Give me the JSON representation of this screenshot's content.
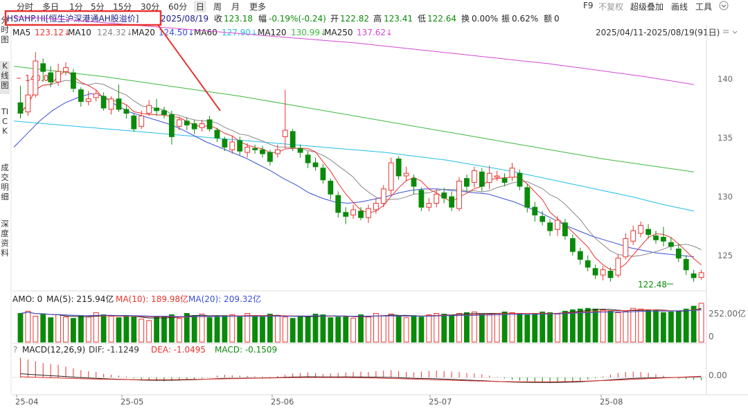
{
  "toolbar": {
    "tabs": [
      "分时",
      "多日",
      "1分",
      "5分",
      "15分",
      "30分",
      "60分",
      "日",
      "周",
      "月",
      "更多"
    ],
    "active_tab": "日",
    "right_items": [
      "F9",
      "不复权",
      "超级叠加",
      "画线",
      "工具"
    ],
    "more_icon": "chevron-down-icon"
  },
  "side_tabs": [
    "分时图",
    "K线图",
    "TICK",
    "成交明细",
    "深度资料"
  ],
  "header": {
    "symbol": "HSAHP.HI[恒生沪深港通AH股溢价]",
    "date": "2025/08/19",
    "close_label": "收",
    "close": "123.18",
    "change_label": "幅",
    "change": "-0.19%(-0.24)",
    "open_label": "开",
    "open": "122.82",
    "high_label": "高",
    "high": "123.41",
    "low_label": "低",
    "low": "122.64",
    "turnover_label": "换",
    "turnover": "0.00%",
    "amplitude_label": "振",
    "amplitude": "0.62%",
    "amount_label": "额",
    "amount": "0"
  },
  "ma_line": {
    "ma5_label": "MA5",
    "ma5": "123.12↓",
    "ma10_label": "MA10",
    "ma10": "124.32↓",
    "ma20_label": "MA20",
    "ma20": "124.50↓",
    "ma60_label": "MA60",
    "ma60": "127.90↓",
    "ma120_label": "MA120",
    "ma120": "130.99↓",
    "ma250_label": "MA250",
    "ma250": "137.62↓",
    "range": "2025/04/11-2025/08/19(91日)"
  },
  "price_axis": [
    "140",
    "135",
    "130",
    "125"
  ],
  "annotations": {
    "max": "140.08",
    "min": "122.48"
  },
  "amo": {
    "label": "AMO: 0",
    "ma5": "MA(5): 215.94亿",
    "ma10": "MA(10): 189.98亿",
    "ma20": "MA(20): 209.32亿",
    "axis_top": "252.00亿",
    "axis_zero": "0"
  },
  "macd": {
    "help": "?",
    "label": "MACD(12,26,9)",
    "dif": "DIF: -1.1249",
    "dea": "DEA: -1.0495",
    "macd": "MACD: -0.1509",
    "axis_zero": "0.00"
  },
  "date_axis": [
    "25-04",
    "25-05",
    "25-06",
    "25-07",
    "25-08"
  ],
  "colors": {
    "up": "#e8332f",
    "down": "#0a8a0a",
    "ma5": "#e8332f",
    "ma10": "#888888",
    "ma20": "#3a4fd8",
    "ma60": "#22bde8",
    "ma120": "#3cb83c",
    "ma250": "#d447d4",
    "highlight": "#e8332f"
  },
  "chart_data": {
    "type": "candlestick",
    "dates_visible": [
      "25-04",
      "25-05",
      "25-06",
      "25-07",
      "25-08"
    ],
    "ylim": [
      122,
      141
    ],
    "candles": [
      {
        "o": 136.2,
        "c": 135.4,
        "h": 137.5,
        "l": 135.0
      },
      {
        "o": 135.5,
        "c": 136.8,
        "h": 138.0,
        "l": 135.2
      },
      {
        "o": 136.8,
        "c": 139.4,
        "h": 140.08,
        "l": 136.6
      },
      {
        "o": 139.2,
        "c": 138.6,
        "h": 139.6,
        "l": 137.8
      },
      {
        "o": 138.5,
        "c": 137.8,
        "h": 139.0,
        "l": 137.4
      },
      {
        "o": 137.8,
        "c": 138.6,
        "h": 139.2,
        "l": 137.5
      },
      {
        "o": 138.6,
        "c": 138.9,
        "h": 139.3,
        "l": 138.3
      },
      {
        "o": 138.5,
        "c": 137.3,
        "h": 138.8,
        "l": 137.0
      },
      {
        "o": 137.2,
        "c": 136.3,
        "h": 137.4,
        "l": 135.9
      },
      {
        "o": 136.3,
        "c": 136.5,
        "h": 137.1,
        "l": 136.0
      },
      {
        "o": 136.6,
        "c": 136.9,
        "h": 137.2,
        "l": 136.3
      },
      {
        "o": 136.7,
        "c": 135.8,
        "h": 137.0,
        "l": 135.6
      },
      {
        "o": 135.7,
        "c": 136.5,
        "h": 136.7,
        "l": 135.3
      },
      {
        "o": 136.5,
        "c": 135.7,
        "h": 137.6,
        "l": 135.5
      },
      {
        "o": 135.7,
        "c": 135.4,
        "h": 136.0,
        "l": 135.0
      },
      {
        "o": 135.2,
        "c": 134.2,
        "h": 135.4,
        "l": 134.0
      },
      {
        "o": 134.4,
        "c": 135.2,
        "h": 135.6,
        "l": 134.2
      },
      {
        "o": 135.4,
        "c": 136.0,
        "h": 136.4,
        "l": 135.2
      },
      {
        "o": 135.8,
        "c": 135.6,
        "h": 136.5,
        "l": 135.2
      },
      {
        "o": 135.6,
        "c": 135.3,
        "h": 135.9,
        "l": 135.0
      },
      {
        "o": 135.3,
        "c": 133.6,
        "h": 135.6,
        "l": 133.0
      },
      {
        "o": 134.4,
        "c": 134.9,
        "h": 135.1,
        "l": 134.1
      },
      {
        "o": 134.8,
        "c": 134.5,
        "h": 135.1,
        "l": 134.1
      },
      {
        "o": 134.6,
        "c": 134.2,
        "h": 134.9,
        "l": 133.8
      },
      {
        "o": 134.3,
        "c": 134.6,
        "h": 134.9,
        "l": 134.0
      },
      {
        "o": 134.9,
        "c": 134.2,
        "h": 135.2,
        "l": 134.0
      },
      {
        "o": 134.1,
        "c": 133.5,
        "h": 134.3,
        "l": 133.2
      },
      {
        "o": 133.4,
        "c": 132.8,
        "h": 133.6,
        "l": 132.5
      },
      {
        "o": 132.6,
        "c": 133.2,
        "h": 133.7,
        "l": 132.3
      },
      {
        "o": 133.3,
        "c": 132.5,
        "h": 133.6,
        "l": 132.2
      },
      {
        "o": 132.4,
        "c": 132.8,
        "h": 133.1,
        "l": 132.0
      },
      {
        "o": 132.7,
        "c": 132.6,
        "h": 133.0,
        "l": 132.3
      },
      {
        "o": 132.6,
        "c": 132.3,
        "h": 132.9,
        "l": 132.0
      },
      {
        "o": 132.4,
        "c": 131.7,
        "h": 132.6,
        "l": 131.4
      },
      {
        "o": 132.3,
        "c": 132.6,
        "h": 133.0,
        "l": 132.0
      },
      {
        "o": 133.6,
        "c": 134.1,
        "h": 137.2,
        "l": 132.7
      },
      {
        "o": 134.0,
        "c": 132.8,
        "h": 134.2,
        "l": 132.5
      },
      {
        "o": 132.7,
        "c": 132.4,
        "h": 133.0,
        "l": 132.0
      },
      {
        "o": 132.2,
        "c": 131.6,
        "h": 132.5,
        "l": 131.2
      },
      {
        "o": 131.6,
        "c": 131.3,
        "h": 132.0,
        "l": 131.0
      },
      {
        "o": 131.2,
        "c": 130.3,
        "h": 131.5,
        "l": 130.0
      },
      {
        "o": 130.2,
        "c": 129.2,
        "h": 130.4,
        "l": 128.8
      },
      {
        "o": 129.1,
        "c": 127.8,
        "h": 129.4,
        "l": 127.4
      },
      {
        "o": 127.8,
        "c": 127.5,
        "h": 128.2,
        "l": 126.9
      },
      {
        "o": 127.6,
        "c": 128.0,
        "h": 128.4,
        "l": 127.3
      },
      {
        "o": 127.9,
        "c": 127.4,
        "h": 128.2,
        "l": 127.2
      },
      {
        "o": 127.4,
        "c": 128.1,
        "h": 128.4,
        "l": 127.0
      },
      {
        "o": 128.0,
        "c": 128.5,
        "h": 128.9,
        "l": 127.7
      },
      {
        "o": 128.5,
        "c": 129.6,
        "h": 129.9,
        "l": 128.2
      },
      {
        "o": 129.5,
        "c": 131.6,
        "h": 132.0,
        "l": 129.1
      },
      {
        "o": 131.9,
        "c": 130.6,
        "h": 132.1,
        "l": 130.3
      },
      {
        "o": 130.6,
        "c": 130.8,
        "h": 131.3,
        "l": 130.2
      },
      {
        "o": 130.4,
        "c": 129.8,
        "h": 130.7,
        "l": 129.2
      },
      {
        "o": 129.5,
        "c": 128.2,
        "h": 129.7,
        "l": 127.9
      },
      {
        "o": 128.2,
        "c": 128.5,
        "h": 128.9,
        "l": 127.9
      },
      {
        "o": 128.5,
        "c": 129.2,
        "h": 129.6,
        "l": 128.2
      },
      {
        "o": 129.3,
        "c": 128.9,
        "h": 129.7,
        "l": 128.5
      },
      {
        "o": 129.0,
        "c": 128.2,
        "h": 129.4,
        "l": 127.9
      },
      {
        "o": 128.1,
        "c": 130.2,
        "h": 130.5,
        "l": 127.9
      },
      {
        "o": 130.4,
        "c": 129.8,
        "h": 130.7,
        "l": 129.4
      },
      {
        "o": 130.1,
        "c": 131.0,
        "h": 131.3,
        "l": 129.7
      },
      {
        "o": 130.9,
        "c": 129.8,
        "h": 131.2,
        "l": 129.4
      },
      {
        "o": 130.1,
        "c": 130.8,
        "h": 131.4,
        "l": 129.6
      },
      {
        "o": 130.5,
        "c": 130.6,
        "h": 131.0,
        "l": 130.2
      },
      {
        "o": 130.4,
        "c": 130.1,
        "h": 130.8,
        "l": 129.8
      },
      {
        "o": 130.5,
        "c": 131.2,
        "h": 131.6,
        "l": 130.2
      },
      {
        "o": 130.8,
        "c": 129.8,
        "h": 131.1,
        "l": 129.5
      },
      {
        "o": 129.7,
        "c": 128.2,
        "h": 130.0,
        "l": 127.8
      },
      {
        "o": 128.2,
        "c": 127.6,
        "h": 128.6,
        "l": 127.1
      },
      {
        "o": 127.5,
        "c": 127.1,
        "h": 127.9,
        "l": 126.8
      },
      {
        "o": 127.0,
        "c": 126.4,
        "h": 127.3,
        "l": 126.0
      },
      {
        "o": 126.5,
        "c": 127.2,
        "h": 127.5,
        "l": 126.0
      },
      {
        "o": 127.0,
        "c": 126.0,
        "h": 127.3,
        "l": 125.7
      },
      {
        "o": 125.8,
        "c": 124.8,
        "h": 126.1,
        "l": 124.5
      },
      {
        "o": 124.8,
        "c": 124.2,
        "h": 125.1,
        "l": 123.8
      },
      {
        "o": 124.1,
        "c": 123.6,
        "h": 124.5,
        "l": 123.3
      },
      {
        "o": 123.5,
        "c": 123.0,
        "h": 123.8,
        "l": 122.7
      },
      {
        "o": 123.0,
        "c": 123.4,
        "h": 123.7,
        "l": 122.6
      },
      {
        "o": 123.3,
        "c": 122.8,
        "h": 123.6,
        "l": 122.5
      },
      {
        "o": 123.0,
        "c": 124.3,
        "h": 124.6,
        "l": 122.8
      },
      {
        "o": 124.4,
        "c": 125.8,
        "h": 126.2,
        "l": 124.2
      },
      {
        "o": 125.6,
        "c": 126.4,
        "h": 126.8,
        "l": 125.3
      },
      {
        "o": 126.2,
        "c": 126.8,
        "h": 127.1,
        "l": 125.9
      },
      {
        "o": 126.5,
        "c": 126.1,
        "h": 126.9,
        "l": 125.8
      },
      {
        "o": 126.0,
        "c": 125.7,
        "h": 126.4,
        "l": 125.4
      },
      {
        "o": 125.9,
        "c": 125.6,
        "h": 126.7,
        "l": 125.2
      },
      {
        "o": 125.5,
        "c": 125.2,
        "h": 125.9,
        "l": 124.9
      },
      {
        "o": 125.0,
        "c": 124.3,
        "h": 125.4,
        "l": 124.0
      },
      {
        "o": 124.2,
        "c": 123.4,
        "h": 124.5,
        "l": 123.0
      },
      {
        "o": 123.1,
        "c": 122.8,
        "h": 123.4,
        "l": 122.48
      },
      {
        "o": 122.82,
        "c": 123.18,
        "h": 123.41,
        "l": 122.64
      }
    ],
    "ma_lines": {
      "MA5": [
        136.0,
        137.5,
        138.5,
        138.2,
        137.6,
        136.9,
        136.5,
        136.4,
        136.2,
        135.9,
        135.6,
        135.4,
        135.3,
        135.3,
        135.3,
        135.0,
        134.6,
        134.4,
        134.2,
        133.8,
        133.5,
        133.2,
        132.9,
        132.6,
        132.3,
        132.1,
        132.1,
        132.1,
        132.2,
        131.8,
        131.0,
        129.9,
        128.9,
        128.0,
        127.7,
        127.9,
        128.6,
        129.6,
        130.0,
        130.0,
        129.7,
        129.3,
        129.1,
        129.0,
        129.4,
        129.7,
        129.9,
        130.1,
        130.4,
        130.6,
        130.3,
        129.5,
        128.5,
        127.6,
        126.8,
        126.3,
        126.1,
        125.7,
        125.1,
        124.3,
        123.7,
        123.5,
        123.7,
        124.4,
        125.3,
        126.0,
        126.1,
        126.0,
        125.6,
        125.1,
        124.4,
        123.6,
        123.1,
        123.1,
        123.1
      ],
      "MA20": [
        132.8,
        133.8,
        134.8,
        135.6,
        136.2,
        136.6,
        136.9,
        136.7,
        136.0,
        135.5,
        135.2,
        134.9,
        134.6,
        134.2,
        133.7,
        133.2,
        132.8,
        132.4,
        132.0,
        131.5,
        131.0,
        130.4,
        129.9,
        129.3,
        128.9,
        128.6,
        128.5,
        128.6,
        128.8,
        129.0,
        129.3,
        129.5,
        129.6,
        129.6,
        129.5,
        129.4,
        129.3,
        129.2,
        128.9,
        128.6,
        128.2,
        127.8,
        127.3,
        126.8,
        126.4,
        126.0,
        125.7,
        125.4,
        125.1,
        124.9,
        124.7,
        124.6,
        124.5,
        124.4
      ],
      "MA60": [
        134.8,
        134.6,
        134.4,
        134.2,
        134.0,
        133.8,
        133.6,
        133.4,
        133.2,
        133.0,
        132.8,
        132.6,
        132.4,
        132.1,
        131.8,
        131.4,
        131.0,
        130.5,
        130.0,
        129.5,
        129.0,
        128.4,
        127.9
      ],
      "MA120": [
        139.0,
        138.6,
        138.2,
        137.7,
        137.2,
        136.7,
        136.1,
        135.5,
        134.9,
        134.3,
        133.7,
        133.1,
        132.5,
        131.9,
        131.4,
        130.9
      ],
      "MA250": [
        142.8,
        142.6,
        142.3,
        142.0,
        141.7,
        141.4,
        141.1,
        140.8,
        140.4,
        140.0,
        139.6,
        139.2,
        138.7,
        138.2,
        137.6
      ]
    },
    "volume": {
      "unit": "亿",
      "values": [
        200,
        215,
        180,
        195,
        170,
        190,
        175,
        165,
        180,
        175,
        205,
        190,
        180,
        170,
        185,
        175,
        160,
        150,
        175,
        180,
        190,
        165,
        200,
        185,
        195,
        170,
        175,
        185,
        190,
        175,
        200,
        180,
        175,
        195,
        185,
        175,
        165,
        180,
        175,
        195,
        190,
        170,
        175,
        180,
        165,
        190,
        175,
        200,
        185,
        195,
        180,
        170,
        185,
        175,
        190,
        200,
        195,
        185,
        200,
        205,
        210,
        195,
        190,
        200,
        210,
        205,
        195,
        190,
        200,
        210,
        205,
        195,
        215,
        225,
        230,
        235,
        230,
        225,
        215,
        205,
        215,
        235,
        230,
        225,
        220,
        205,
        210,
        215,
        230,
        250,
        270
      ],
      "ylim": [
        0,
        260
      ]
    },
    "macd_hist": [
      1.1,
      1.0,
      0.9,
      0.8,
      0.75,
      0.7,
      0.6,
      0.5,
      0.4,
      0.35,
      0.3,
      0.2,
      0.15,
      0.1,
      0.05,
      -0.05,
      -0.12,
      -0.18,
      -0.2,
      -0.22,
      -0.2,
      -0.18,
      -0.15,
      -0.1,
      -0.05,
      0.0,
      0.1,
      0.15,
      0.12,
      0.1,
      0.08,
      0.06,
      0.05,
      0.04,
      0.08,
      0.15,
      0.22,
      0.25,
      0.28,
      0.25,
      0.2,
      0.22,
      0.25,
      0.28,
      0.3,
      0.32,
      0.3,
      0.35,
      0.38,
      0.4,
      0.35,
      0.3,
      0.28,
      0.32,
      0.36,
      0.38,
      0.35,
      0.33,
      0.3,
      0.25,
      0.22,
      0.18,
      0.1,
      0.02,
      -0.05,
      -0.12,
      -0.18,
      -0.22,
      -0.25,
      -0.27,
      -0.3,
      -0.3,
      -0.28,
      -0.25,
      -0.2,
      -0.12,
      -0.05,
      0.05,
      0.15,
      0.25,
      0.3,
      0.32,
      0.3,
      0.25,
      0.18,
      0.1,
      0.02,
      -0.06,
      -0.1,
      -0.13,
      -0.15
    ]
  }
}
